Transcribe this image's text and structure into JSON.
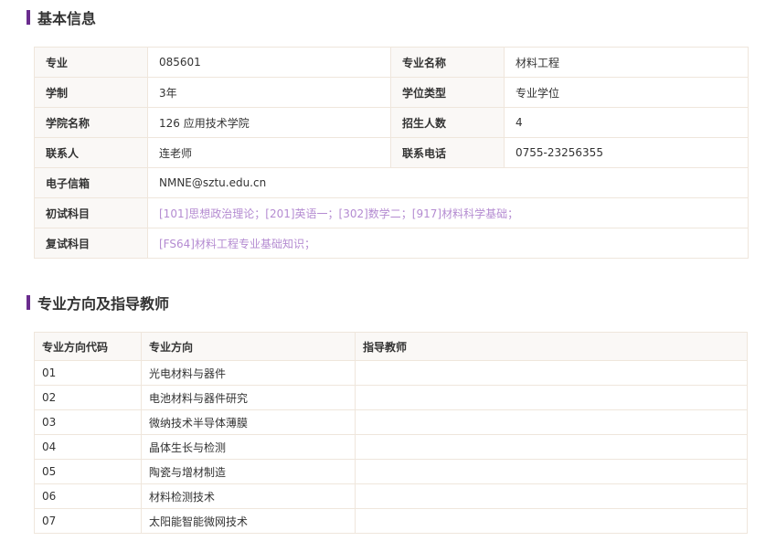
{
  "section1": {
    "title": "基本信息"
  },
  "info": {
    "rows": [
      [
        {
          "label": "专业",
          "value": "085601"
        },
        {
          "label": "专业名称",
          "value": "材料工程"
        }
      ],
      [
        {
          "label": "学制",
          "value": "3年"
        },
        {
          "label": "学位类型",
          "value": "专业学位"
        }
      ],
      [
        {
          "label": "学院名称",
          "value": "126 应用技术学院"
        },
        {
          "label": "招生人数",
          "value": "4"
        }
      ],
      [
        {
          "label": "联系人",
          "value": "连老师"
        },
        {
          "label": "联系电话",
          "value": "0755-23256355"
        }
      ]
    ],
    "email_label": "电子信箱",
    "email_value": "NMNE@sztu.edu.cn",
    "exam1_label": "初试科目",
    "exam1_value": "[101]思想政治理论；[201]英语一；[302]数学二；[917]材料科学基础；",
    "exam2_label": "复试科目",
    "exam2_value": "[FS64]材料工程专业基础知识；"
  },
  "section2": {
    "title": "专业方向及指导教师"
  },
  "directions": {
    "headers": [
      "专业方向代码",
      "专业方向",
      "指导教师"
    ],
    "rows": [
      {
        "code": "01",
        "name": "光电材料与器件",
        "teacher": ""
      },
      {
        "code": "02",
        "name": "电池材料与器件研究",
        "teacher": ""
      },
      {
        "code": "03",
        "name": "微纳技术半导体薄膜",
        "teacher": ""
      },
      {
        "code": "04",
        "name": "晶体生长与检测",
        "teacher": ""
      },
      {
        "code": "05",
        "name": "陶瓷与增材制造",
        "teacher": ""
      },
      {
        "code": "06",
        "name": "材料检测技术",
        "teacher": ""
      },
      {
        "code": "07",
        "name": "太阳能智能微网技术",
        "teacher": ""
      }
    ]
  },
  "colors": {
    "accent": "#6a2c8e",
    "link": "#b48bd1",
    "border": "#efe6dc",
    "label_bg": "#faf8f6"
  }
}
